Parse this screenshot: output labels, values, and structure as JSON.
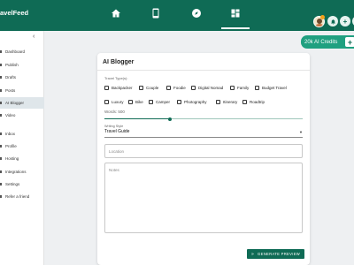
{
  "app": {
    "brand": "avelFeed"
  },
  "topnav": {
    "items": [
      {
        "name": "home",
        "icon": "home-icon"
      },
      {
        "name": "mobile",
        "icon": "mobile-icon"
      },
      {
        "name": "explore",
        "icon": "compass-icon"
      },
      {
        "name": "dashboard",
        "icon": "grid-icon",
        "active": true
      }
    ],
    "plus_label": "+",
    "more_label": "⋮"
  },
  "sidebar": {
    "collapse_glyph": "‹",
    "items": [
      {
        "label": "Dashboard"
      },
      {
        "label": "Publish"
      },
      {
        "label": "Drafts"
      },
      {
        "label": "Posts"
      },
      {
        "label": "AI Blogger",
        "active": true
      },
      {
        "label": "Video"
      },
      {
        "label": "Inbox"
      },
      {
        "label": "Profile"
      },
      {
        "label": "Hosting"
      },
      {
        "label": "Integrations"
      },
      {
        "label": "Settings"
      },
      {
        "label": "Refer a friend"
      }
    ]
  },
  "credits": {
    "label": "20k AI Credits",
    "plus": "+"
  },
  "form": {
    "title": "AI Blogger",
    "travel_types_label": "Travel Type(s):",
    "travel_types_row1": [
      "Backpacker",
      "Couple",
      "Foodie",
      "Digital Nomad",
      "Family",
      "Budget Travel"
    ],
    "travel_types_row2": [
      "Luxury",
      "Bike",
      "Camper",
      "Photography",
      "Itinerary",
      "Roadtrip"
    ],
    "words_label": "Words: 500",
    "words_value": 500,
    "words_fraction": 0.33,
    "writing_style_label": "Writing Style",
    "writing_style_value": "Travel Guide",
    "location_placeholder": "Location",
    "notes_placeholder": "Notes",
    "generate_label": "GENERATE PREVIEW"
  }
}
